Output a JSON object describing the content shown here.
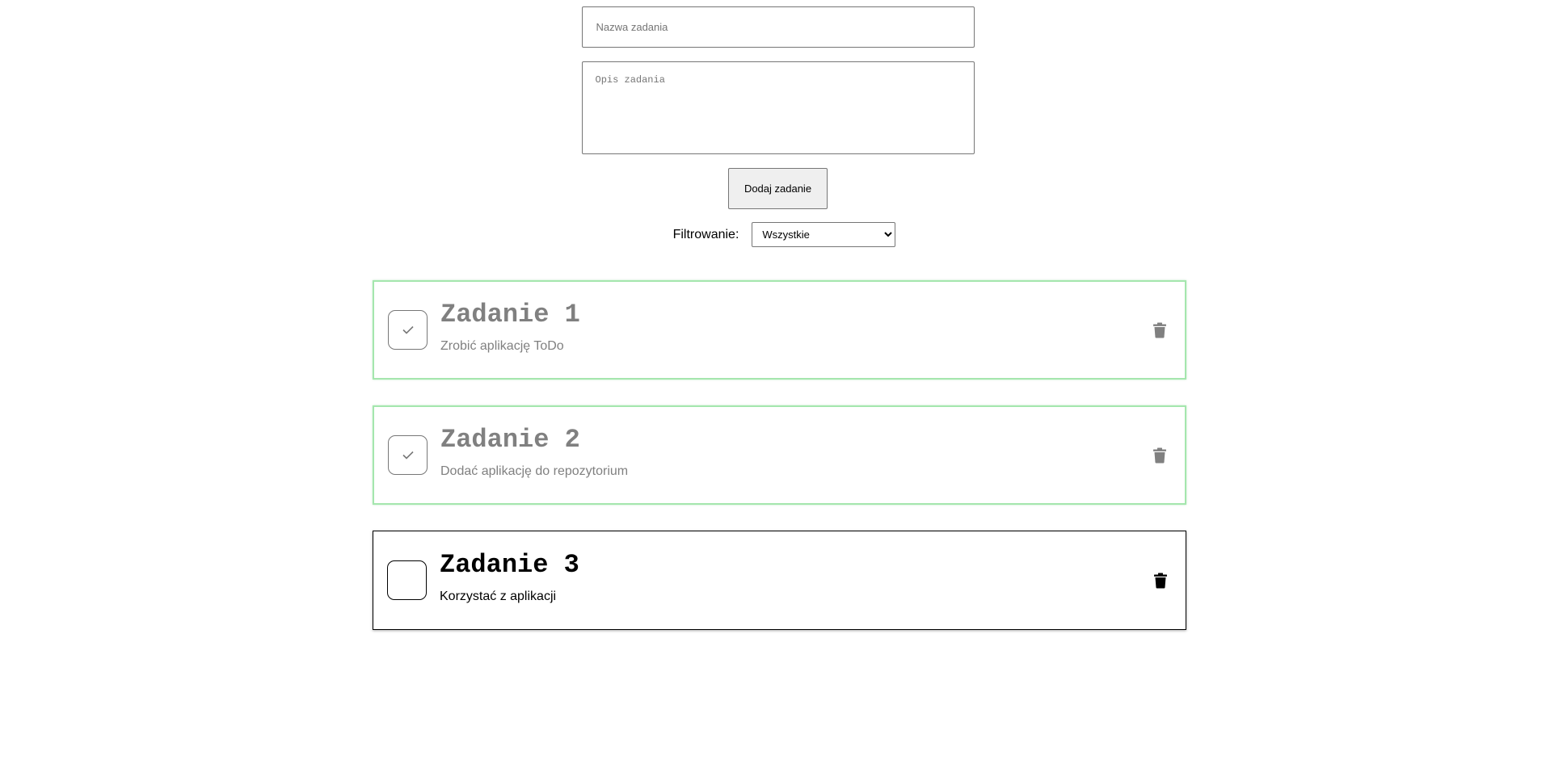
{
  "form": {
    "name_placeholder": "Nazwa zadania",
    "desc_placeholder": "Opis zadania",
    "add_label": "Dodaj zadanie"
  },
  "filter": {
    "label": "Filtrowanie:",
    "selected": "Wszystkie"
  },
  "tasks": [
    {
      "title": "Zadanie 1",
      "description": "Zrobić aplikację ToDo",
      "done": true
    },
    {
      "title": "Zadanie 2",
      "description": "Dodać aplikację do repozytorium",
      "done": true
    },
    {
      "title": "Zadanie 3",
      "description": "Korzystać z aplikacji",
      "done": false
    }
  ],
  "colors": {
    "done_border": "#a5e6ae",
    "done_text": "#808080",
    "open_border": "#000000"
  },
  "icons": {
    "check": "check-icon",
    "delete": "trash-icon"
  }
}
